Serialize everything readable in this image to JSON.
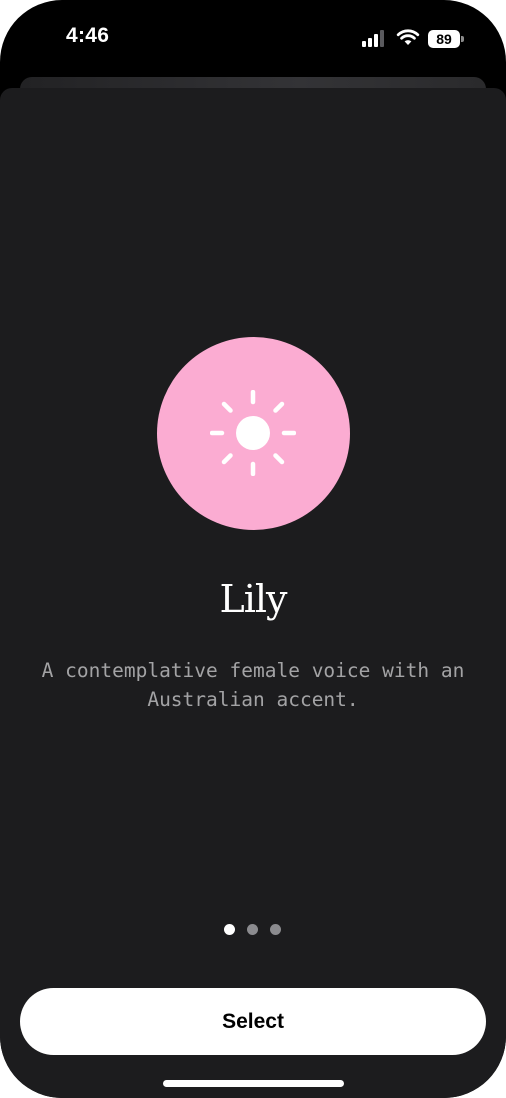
{
  "status_bar": {
    "time": "4:46",
    "battery_level": "89",
    "icons": [
      "signal-icon",
      "wifi-icon",
      "battery-icon"
    ]
  },
  "voice": {
    "name": "Lily",
    "description": "A contemplative female voice with an Australian accent.",
    "avatar_color": "#fbacd2",
    "icon": "sun-icon"
  },
  "pager": {
    "total": 3,
    "active_index": 0
  },
  "actions": {
    "select_label": "Select"
  },
  "colors": {
    "background": "#1c1c1e",
    "text_primary": "#ffffff",
    "text_secondary": "#a3a3a5",
    "button_background": "#ffffff"
  }
}
